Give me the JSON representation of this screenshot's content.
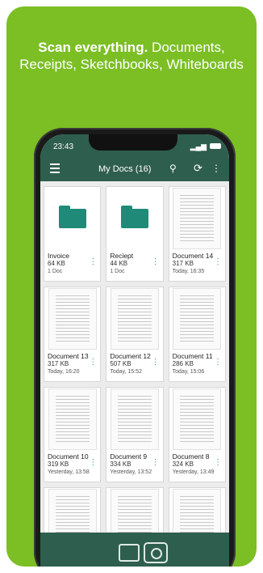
{
  "headline": {
    "bold": "Scan everything.",
    "rest": " Documents, Receipts, Sketchbooks, Whiteboards"
  },
  "status": {
    "time": "23:43"
  },
  "appbar": {
    "title": "My Docs (16)"
  },
  "items": [
    {
      "name": "Invoice",
      "size": "64 KB",
      "date": "1 Doc",
      "type": "folder"
    },
    {
      "name": "Reciept",
      "size": "44 KB",
      "date": "1 Doc",
      "type": "folder"
    },
    {
      "name": "Document 14",
      "size": "317 KB",
      "date": "Today, 16:35",
      "type": "doc"
    },
    {
      "name": "Document 13",
      "size": "317 KB",
      "date": "Today, 16:20",
      "type": "doc"
    },
    {
      "name": "Document 12",
      "size": "507 KB",
      "date": "Today, 15:52",
      "type": "doc"
    },
    {
      "name": "Document 11",
      "size": "286 KB",
      "date": "Today, 15:06",
      "type": "doc"
    },
    {
      "name": "Document 10",
      "size": "319 KB",
      "date": "Yesterday, 13:58",
      "type": "doc"
    },
    {
      "name": "Document 9",
      "size": "334 KB",
      "date": "Yesterday, 13:52",
      "type": "doc"
    },
    {
      "name": "Document 8",
      "size": "324 KB",
      "date": "Yesterday, 13:49",
      "type": "doc"
    }
  ]
}
